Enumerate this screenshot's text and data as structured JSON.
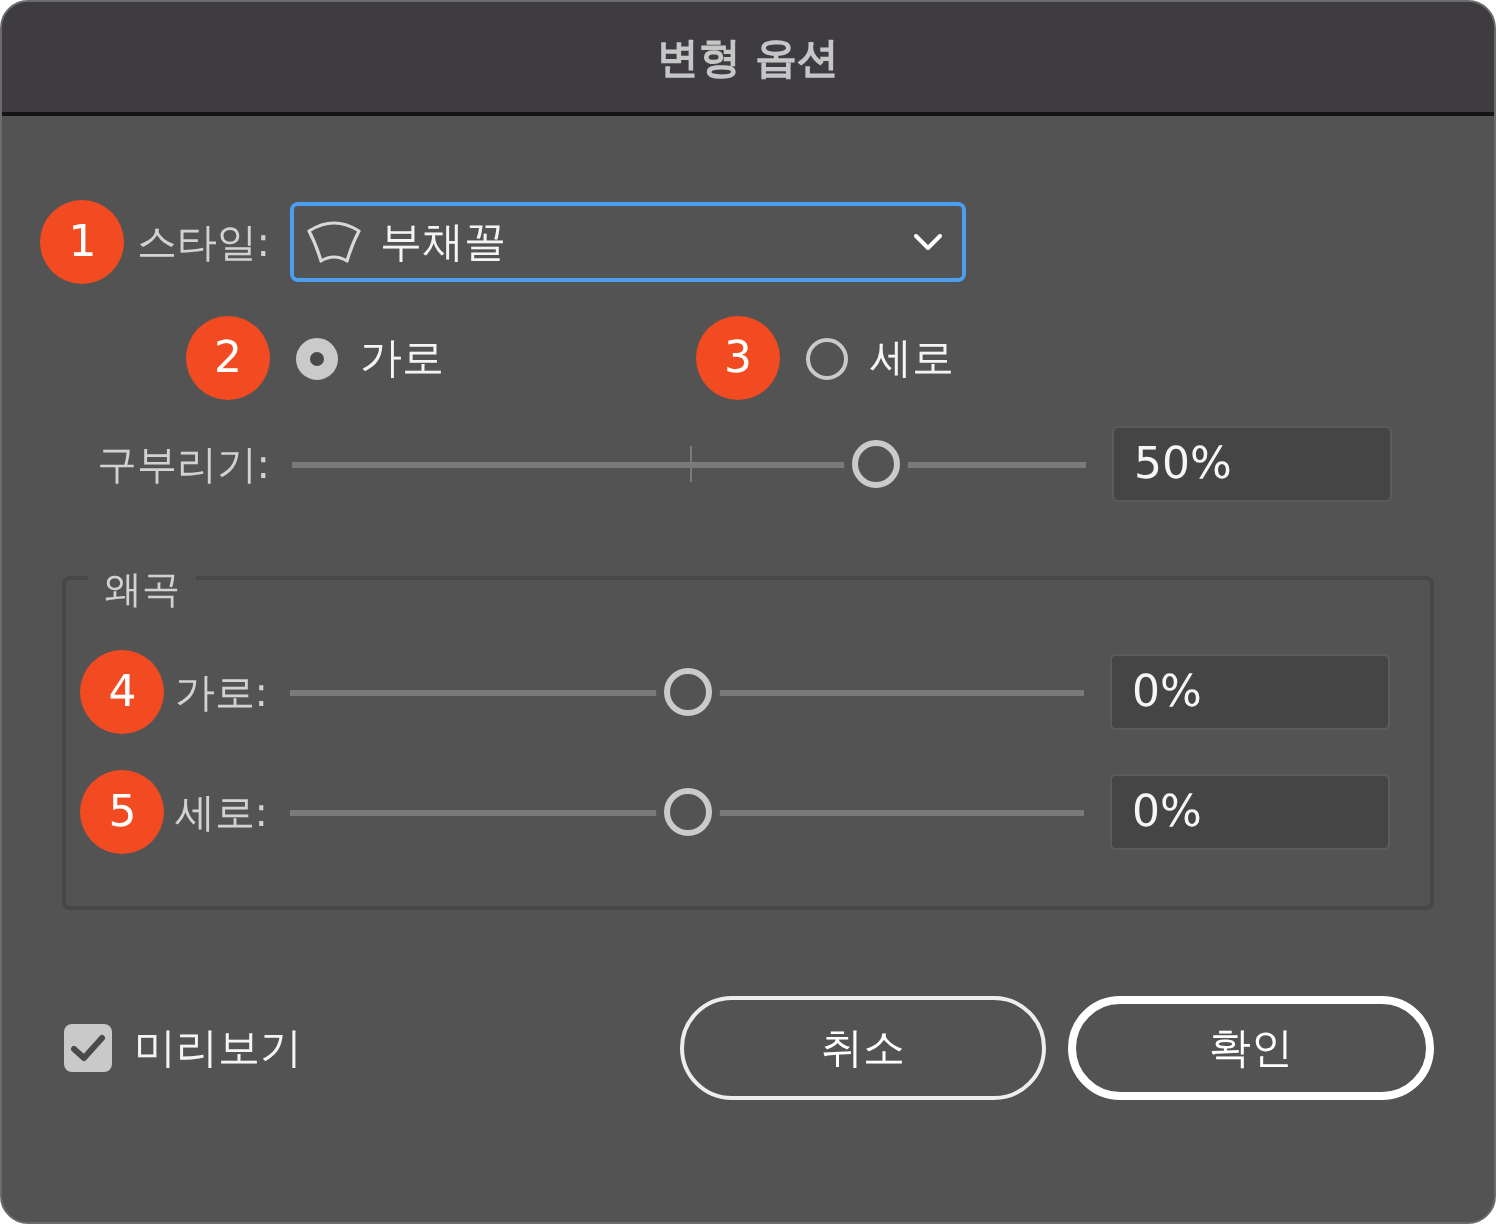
{
  "window": {
    "title": "변형 옵션"
  },
  "style": {
    "label": "스타일:",
    "value": "부채꼴",
    "focused": true,
    "callout": "1"
  },
  "orientation": [
    {
      "label": "가로",
      "selected": true,
      "callout": "2"
    },
    {
      "label": "세로",
      "selected": false,
      "callout": "3"
    }
  ],
  "bend": {
    "label": "구부리기:",
    "level": 0.75,
    "value": "50%"
  },
  "distortion": {
    "title": "왜곡",
    "sliders": [
      {
        "label": "가로:",
        "level": 0.5,
        "value": "0%",
        "callout": "4"
      },
      {
        "label": "세로:",
        "level": 0.5,
        "value": "0%",
        "callout": "5"
      }
    ]
  },
  "preview": {
    "label": "미리보기",
    "checked": true
  },
  "buttons": [
    {
      "label": "취소",
      "kind": "cancel"
    },
    {
      "label": "확인",
      "kind": "confirm"
    }
  ]
}
